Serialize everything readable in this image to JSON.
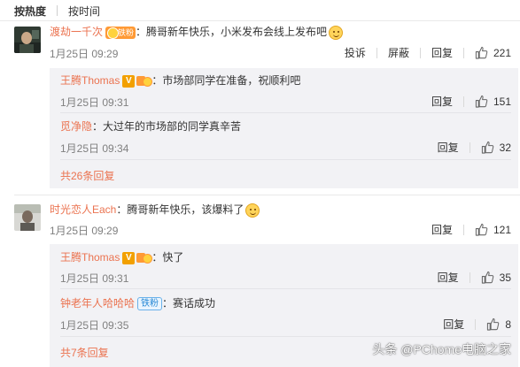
{
  "sort": {
    "hot": "按热度",
    "time": "按时间"
  },
  "actions": {
    "report": "投诉",
    "block": "屏蔽",
    "reply": "回复"
  },
  "colors": {
    "username": "#eb7350",
    "reply_bg": "#f2f2f5",
    "time": "#808080",
    "tiefen_badge": "#2a8ad6"
  },
  "comments": [
    {
      "user": "渡劫一千次",
      "badge": "铁粉",
      "text": "：腾哥新年快乐，小米发布会线上发布吧",
      "emoji": "doge-emoji",
      "time": "1月25日 09:29",
      "likes": "221",
      "replies": [
        {
          "user": "王腾Thomas",
          "text": "：市场部同学在准备，祝顺利吧",
          "time": "1月25日 09:31",
          "likes": "151"
        },
        {
          "user": "觅净隐",
          "text": "：大过年的市场部的同学真辛苦",
          "time": "1月25日 09:34",
          "likes": "32"
        }
      ],
      "more": "共26条回复"
    },
    {
      "user": "时光恋人Each",
      "text": "：腾哥新年快乐，该爆料了",
      "emoji": "doge-emoji",
      "time": "1月25日 09:29",
      "likes": "121",
      "replies": [
        {
          "user": "王腾Thomas",
          "text": "：快了",
          "time": "1月25日 09:31",
          "likes": "35"
        },
        {
          "user": "钟老年人哈哈哈",
          "badge": "铁粉",
          "text": "：赛话成功",
          "time": "1月25日 09:35",
          "likes": "8"
        }
      ],
      "more": "共7条回复"
    }
  ],
  "watermark": "头条 @PChome电脑之家"
}
